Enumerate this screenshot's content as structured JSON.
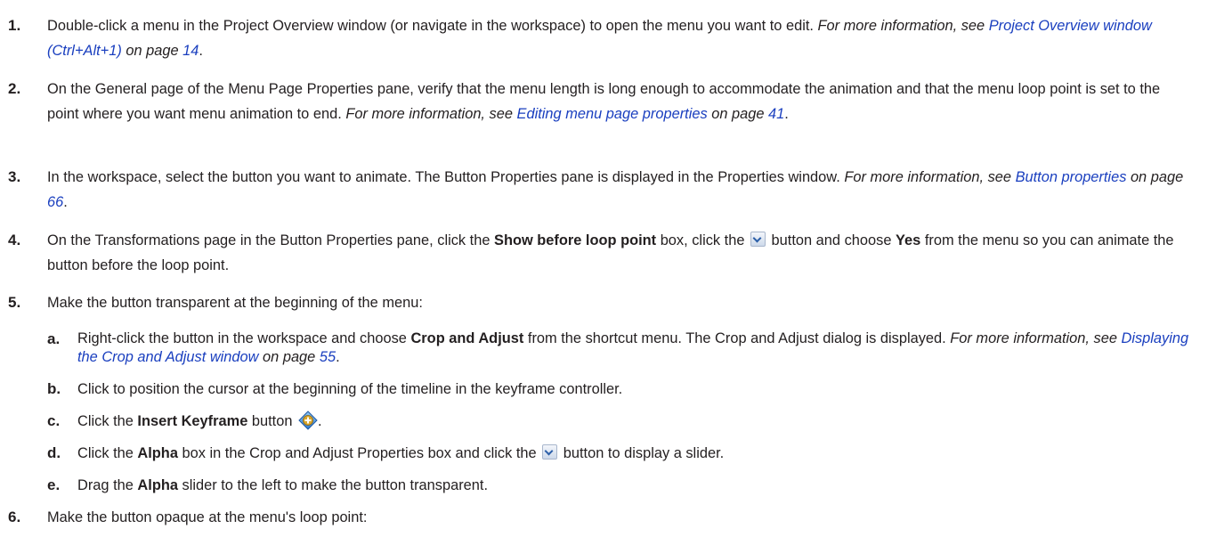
{
  "steps": [
    {
      "num": "1.",
      "t1": "Double-click a menu in the Project Overview window (or navigate in the workspace) to open the menu you want to edit. ",
      "i1": "For more information, see ",
      "link": "Project Overview window (Ctrl+Alt+1)",
      "i2": " on page ",
      "page": "14",
      "end": "."
    },
    {
      "num": "2.",
      "t1": "On the General page of the Menu Page Properties pane, verify that the menu length is long enough to accommodate the animation and that the menu loop point is set to the point where you want menu animation to end. ",
      "i1": "For more information, see ",
      "link": "Editing menu page properties",
      "i2": " on page ",
      "page": "41",
      "end": "."
    },
    {
      "num": "3.",
      "t1": "In the workspace, select the button you want to animate. The Button Properties pane is displayed in the Properties window. ",
      "i1": "For more information, see ",
      "link": "Button properties",
      "i2": " on page ",
      "page": "66",
      "end": "."
    },
    {
      "num": "4.",
      "t1": "On the Transformations page in the Button Properties pane, click the ",
      "b1": "Show before loop point",
      "t2": " box, click the ",
      "t3": " button and choose ",
      "b2": "Yes",
      "t4": " from the menu so you can animate the button before the loop point."
    },
    {
      "num": "5.",
      "t1": "Make the button transparent at the beginning of the menu:"
    },
    {
      "num": "6.",
      "t1": "Make the button opaque at the menu's loop point:"
    }
  ],
  "substeps": [
    {
      "num": "a.",
      "t1": "Right-click the button in the workspace and choose ",
      "b1": "Crop and Adjust",
      "t2": " from the shortcut menu. The Crop and Adjust dialog is displayed. ",
      "i1": "For more information, see ",
      "link": "Displaying the Crop and Adjust window",
      "i2": " on page ",
      "page": "55",
      "end": "."
    },
    {
      "num": "b.",
      "t1": "Click to position the cursor at the beginning of the timeline in the keyframe controller."
    },
    {
      "num": "c.",
      "t1": "Click the ",
      "b1": "Insert Keyframe",
      "t2": " button",
      "end": "."
    },
    {
      "num": "d.",
      "t1": "Click the ",
      "b1": "Alpha",
      "t2": " box in the Crop and Adjust Properties box and click the ",
      "t3": " button to display a slider."
    },
    {
      "num": "e.",
      "t1": "Drag the ",
      "b1": "Alpha",
      "t2": " slider to the left to make the button transparent."
    }
  ],
  "icons": {
    "dropdown": "dropdown-arrow-icon",
    "keyframe": "insert-keyframe-icon"
  },
  "colors": {
    "text": "#231f20",
    "link": "#1a3fbf"
  }
}
